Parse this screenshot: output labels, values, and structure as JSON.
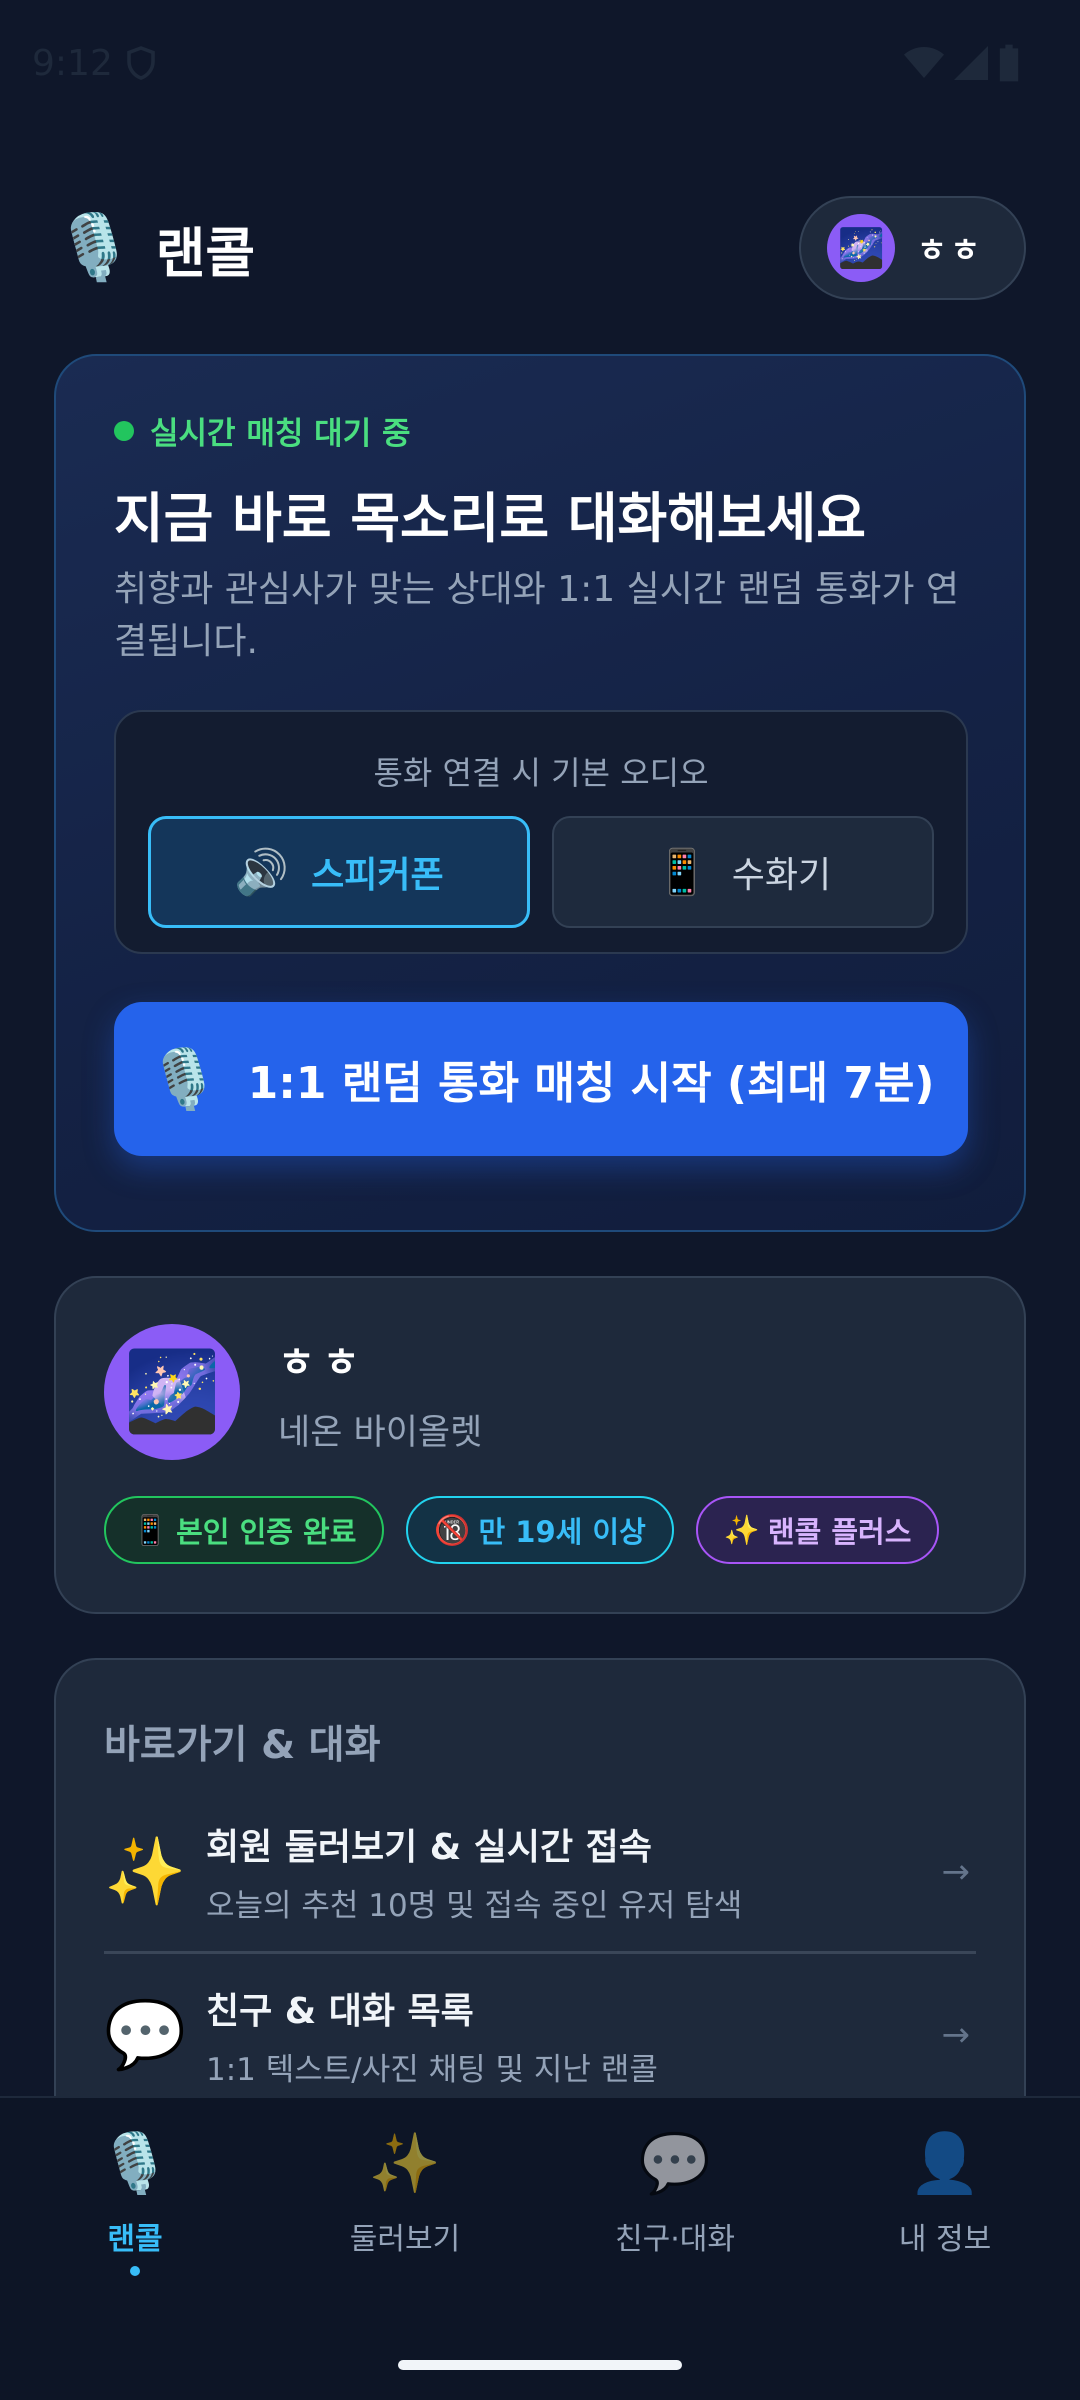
{
  "status_bar": {
    "time": "9:12",
    "icons": [
      "vpn-shield-icon",
      "wifi-icon",
      "signal-icon",
      "battery-icon"
    ]
  },
  "header": {
    "brand_icon": "🎙️",
    "brand_title": "랜콜",
    "profile_avatar": "🌌",
    "profile_name": "ㅎㅎ"
  },
  "hero": {
    "status": "실시간 매칭 대기 중",
    "title": "지금 바로 목소리로 대화해보세요",
    "description": "취향과 관심사가 맞는 상대와 1:1 실시간 랜덤 통화가 연결됩니다.",
    "audio": {
      "label": "통화 연결 시 기본 오디오",
      "options": [
        {
          "icon": "🔊",
          "label": "스피커폰",
          "selected": true
        },
        {
          "icon": "📱",
          "label": "수화기",
          "selected": false
        }
      ]
    },
    "match_button": {
      "icon": "🎙️",
      "label": "1:1 랜덤 통화 매칭 시작 (최대 7분)"
    }
  },
  "profile": {
    "avatar": "🌌",
    "name": "ㅎㅎ",
    "theme": "네온 바이올렛",
    "badges": [
      {
        "icon": "📱",
        "label": "본인 인증 완료",
        "color": "#22c55e"
      },
      {
        "icon": "🔞",
        "label": "만 19세 이상",
        "color": "#22d3ee"
      },
      {
        "icon": "✨",
        "label": "랜콜 플러스",
        "color": "#a855f7"
      }
    ]
  },
  "shortcuts": {
    "title": "바로가기 & 대화",
    "items": [
      {
        "icon": "✨",
        "title": "회원 둘러보기 & 실시간 접속",
        "subtitle": "오늘의 추천 10명 및 접속 중인 유저 탐색",
        "arrow": "→"
      },
      {
        "icon": "💬",
        "title": "친구 & 대화 목록",
        "subtitle": "1:1 텍스트/사진 채팅 및 지난 랜콜",
        "arrow": "→"
      }
    ]
  },
  "bottom_nav": {
    "items": [
      {
        "icon": "🎙️",
        "label": "랜콜",
        "active": true
      },
      {
        "icon": "✨",
        "label": "둘러보기",
        "active": false
      },
      {
        "icon": "💬",
        "label": "친구·대화",
        "active": false
      },
      {
        "icon": "👤",
        "label": "내 정보",
        "active": false
      }
    ]
  },
  "colors": {
    "background": "#0f172a",
    "accent_blue": "#2563eb",
    "accent_cyan": "#38bdf8",
    "online_green": "#22c55e",
    "avatar_purple": "#8b5cf6"
  }
}
